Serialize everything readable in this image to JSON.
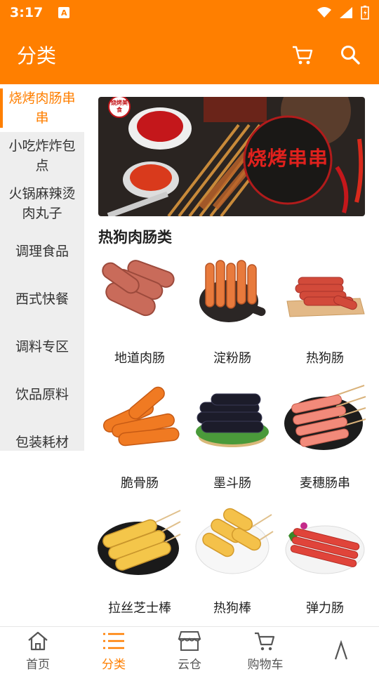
{
  "status_bar": {
    "time": "3:17",
    "app_indicator": "A"
  },
  "appbar": {
    "title": "分类",
    "icons": [
      "cart-icon",
      "search-icon"
    ]
  },
  "sidebar": {
    "items": [
      {
        "label": "烧烤肉肠串串",
        "active": true
      },
      {
        "label": "小吃炸炸包点"
      },
      {
        "label": "火锅麻辣烫肉丸子"
      },
      {
        "label": "调理食品"
      },
      {
        "label": "西式快餐"
      },
      {
        "label": "调料专区"
      },
      {
        "label": "饮品原料"
      },
      {
        "label": "包装耗材"
      }
    ]
  },
  "banner": {
    "text": "烧烤串串",
    "badge": "烧烤美食"
  },
  "section": {
    "title": "热狗肉肠类"
  },
  "products": [
    {
      "name": "地道肉肠"
    },
    {
      "name": "淀粉肠"
    },
    {
      "name": "热狗肠"
    },
    {
      "name": "脆骨肠"
    },
    {
      "name": "墨斗肠"
    },
    {
      "name": "麦穗肠串"
    },
    {
      "name": "拉丝芝士棒"
    },
    {
      "name": "热狗棒"
    },
    {
      "name": "弹力肠"
    }
  ],
  "bottom_nav": [
    {
      "label": "首页",
      "icon": "home-icon"
    },
    {
      "label": "分类",
      "icon": "list-icon",
      "active": true
    },
    {
      "label": "云仓",
      "icon": "store-icon"
    },
    {
      "label": "购物车",
      "icon": "cart-icon"
    },
    {
      "label": "",
      "icon": "up-icon"
    }
  ],
  "colors": {
    "accent": "#FF7F00",
    "sidebar_bg": "#eeeeee"
  }
}
